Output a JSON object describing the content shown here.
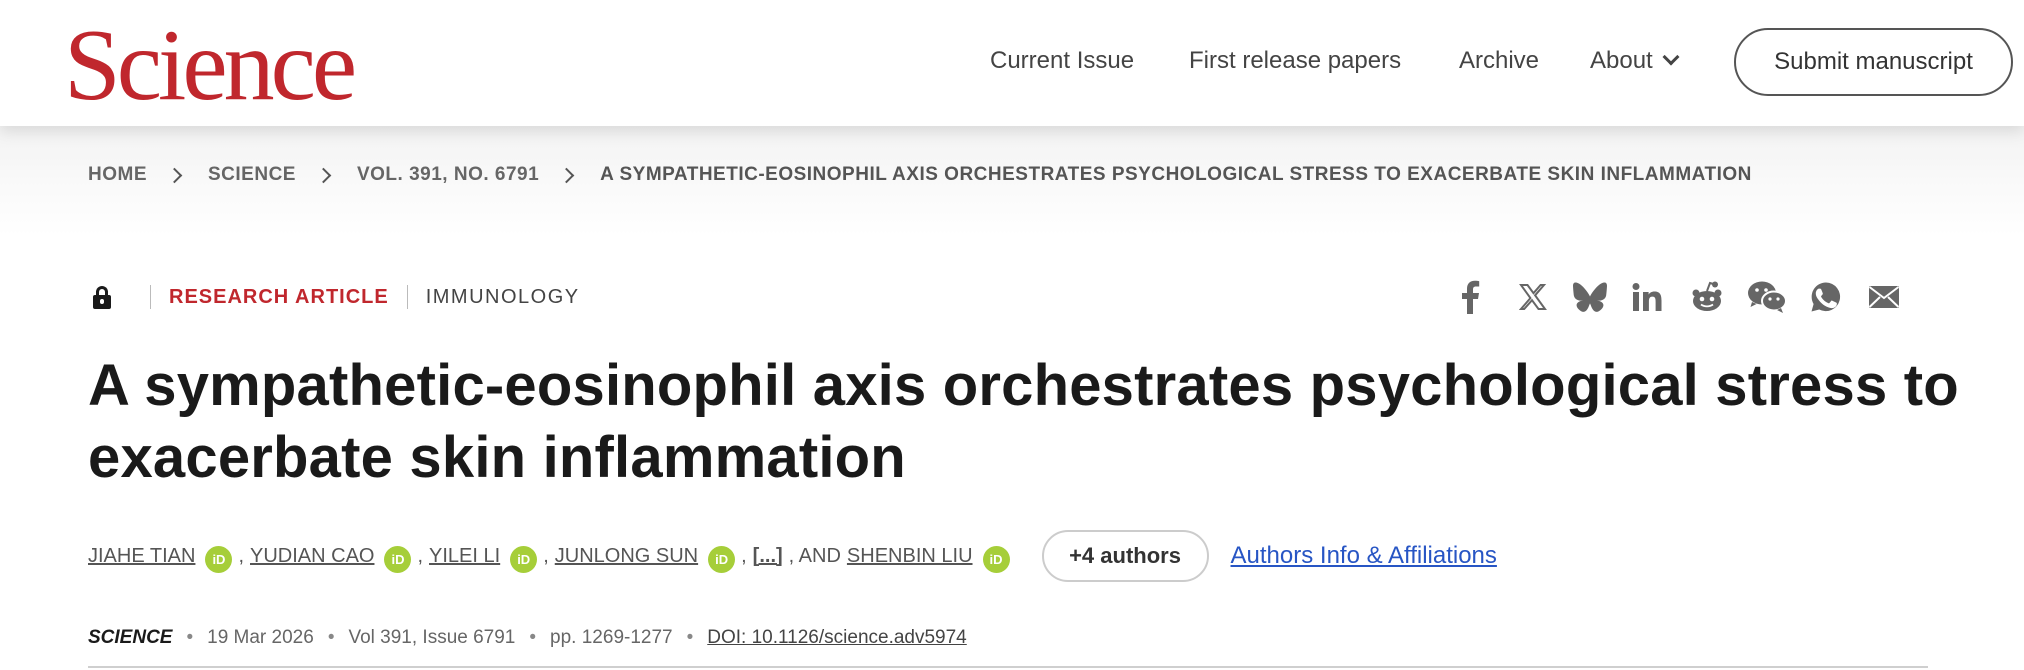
{
  "header": {
    "logo": "Science",
    "nav": [
      "Current Issue",
      "First release papers",
      "Archive",
      "About"
    ],
    "submit_label": "Submit manuscript"
  },
  "breadcrumb": [
    "HOME",
    "SCIENCE",
    "VOL. 391, NO. 6791",
    "A SYMPATHETIC-EOSINOPHIL AXIS ORCHESTRATES PSYCHOLOGICAL STRESS TO EXACERBATE SKIN INFLAMMATION"
  ],
  "article": {
    "type": "RESEARCH ARTICLE",
    "subject": "IMMUNOLOGY",
    "title_line1": "A sympathetic-eosinophil axis orchestrates psychological stress to",
    "title_line2": "exacerbate skin inflammation",
    "authors": [
      "JIAHE TIAN",
      "YUDIAN CAO",
      "YILEI LI",
      "JUNLONG SUN",
      "SHENBIN LIU"
    ],
    "comma": ",",
    "ellipsis": "[...]",
    "and_text": ", AND",
    "orcid_badge": "iD",
    "more_authors": "+4 authors",
    "affiliations_link": "Authors Info & Affiliations",
    "journal": "SCIENCE",
    "date": "19 Mar 2026",
    "volume": "Vol 391, Issue 6791",
    "pages": "pp. 1269-1277",
    "doi": "DOI: 10.1126/science.adv5974",
    "bullet": "•"
  },
  "share_icons": [
    "facebook-icon",
    "x-icon",
    "bluesky-icon",
    "linkedin-icon",
    "reddit-icon",
    "wechat-icon",
    "whatsapp-icon",
    "email-icon"
  ],
  "colors": {
    "brand": "#c0272d",
    "link": "#2755c4",
    "orcid": "#a6ce39"
  }
}
